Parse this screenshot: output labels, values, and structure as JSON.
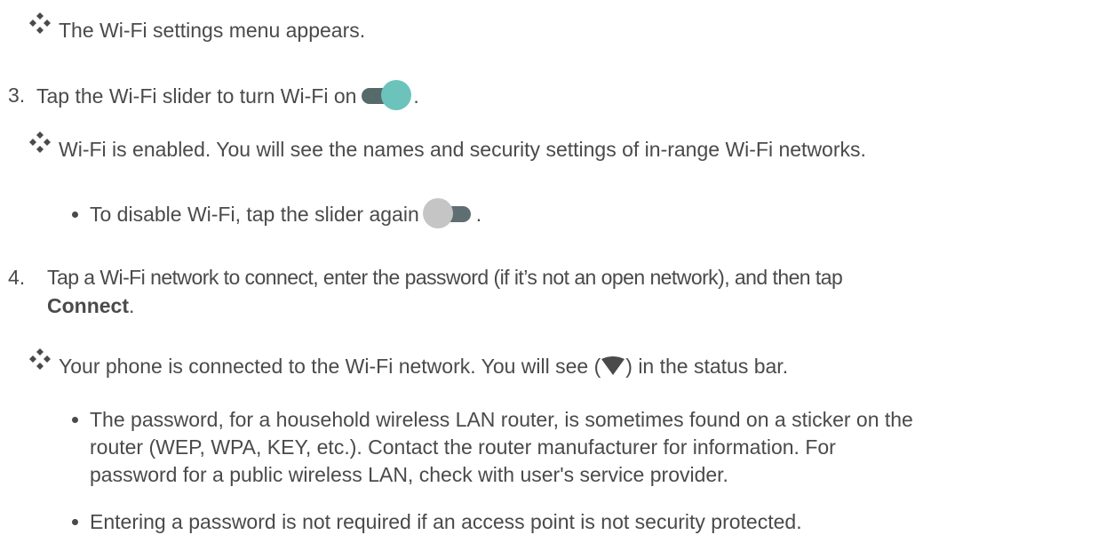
{
  "steps": [
    {
      "result": "The Wi-Fi settings menu appears."
    },
    {
      "number": "3.",
      "text_before": "Tap the Wi-Fi slider to turn Wi-Fi on",
      "text_after": ".",
      "result": "Wi-Fi is enabled. You will see the names and security settings of in-range Wi-Fi networks.",
      "sub": {
        "text_before": "To disable Wi-Fi, tap the slider again",
        "text_after": "."
      }
    },
    {
      "number": "4.",
      "text_line1": "Tap a Wi-Fi network to connect, enter the password (if it’s not an open network), and then tap",
      "bold": "Connect",
      "text_after": ".",
      "result_before": "Your phone is connected to the Wi-Fi network. You will see (",
      "result_after": ") in the status bar.",
      "notes": [
        {
          "line1": "The password, for a household wireless LAN router, is sometimes found on a sticker on the",
          "line2": "router (WEP, WPA, KEY, etc.). Contact the router manufacturer for information. For",
          "line3": "password for a public wireless LAN, check with user's service provider."
        },
        {
          "line1": "Entering a password is not required if an access point is not security protected."
        }
      ]
    }
  ],
  "colors": {
    "text": "#4a4a4a",
    "toggle_on_knob": "#6cc3bb",
    "toggle_off_knob": "#c5c5c5",
    "toggle_track": "#5d6e70"
  },
  "icons": [
    "diamond-bullet-icon",
    "toggle-on-icon",
    "toggle-off-icon",
    "wifi-signal-icon"
  ]
}
